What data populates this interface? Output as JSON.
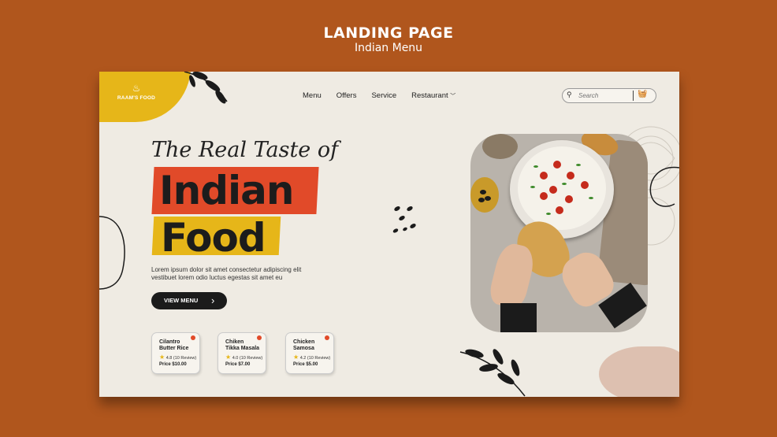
{
  "header": {
    "title": "LANDING PAGE",
    "subtitle": "Indian Menu"
  },
  "logo": {
    "text": "RAAM'S FOOD",
    "icon": "chef-hat-icon"
  },
  "nav": {
    "items": [
      "Menu",
      "Offers",
      "Service",
      "Restaurant"
    ]
  },
  "search": {
    "placeholder": "Search"
  },
  "hero": {
    "tagline": "The Real Taste of",
    "title_line1": "Indian",
    "title_line2": "Food",
    "description": "Lorem ipsum dolor sit amet consectetur adipiscing elit vestibuet lorem odio luctus egestas sit amet eu",
    "cta_label": "VIEW MENU"
  },
  "dishes": [
    {
      "name_line1": "Cilantro",
      "name_line2": "Butter Rice",
      "rating": "4.8",
      "reviews": "(10 Review)",
      "price": "Price $10.00"
    },
    {
      "name_line1": "Chiken",
      "name_line2": "Tikka Masala",
      "rating": "4.0",
      "reviews": "(10 Review)",
      "price": "Price $7.00"
    },
    {
      "name_line1": "Chicken",
      "name_line2": "Samosa",
      "rating": "4.2",
      "reviews": "(10 Review)",
      "price": "Price $5.00"
    }
  ],
  "colors": {
    "background": "#b0561d",
    "card": "#efebe3",
    "accent_yellow": "#e6b619",
    "accent_red": "#e14a29",
    "dark": "#1b1b1b"
  }
}
